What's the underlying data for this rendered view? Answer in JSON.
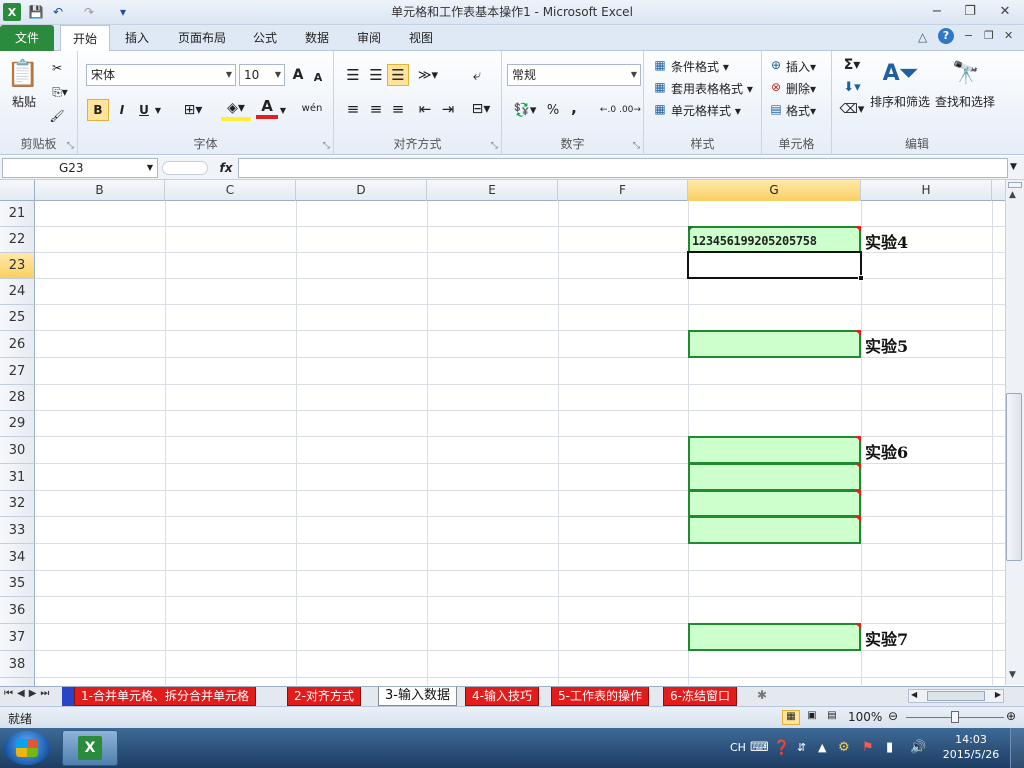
{
  "window": {
    "title": "单元格和工作表基本操作1 - Microsoft Excel",
    "app_icon": "excel-icon",
    "controls": {
      "minimize": "−",
      "maximize": "❐",
      "close": "✕"
    }
  },
  "quick_access": {
    "save": "save-icon",
    "undo": "undo-icon",
    "redo": "redo-icon",
    "customize": "▾"
  },
  "ribbon_tabs": [
    "文件",
    "开始",
    "插入",
    "页面布局",
    "公式",
    "数据",
    "审阅",
    "视图"
  ],
  "active_tab": "开始",
  "ribbon": {
    "clipboard": {
      "label": "剪贴板",
      "paste": "粘贴"
    },
    "font": {
      "label": "字体",
      "name": "宋体",
      "size": "10",
      "bold": "B",
      "italic": "I",
      "underline": "U",
      "grow": "A",
      "shrink": "A",
      "wen": "wén",
      "fontcolor": "A"
    },
    "alignment": {
      "label": "对齐方式"
    },
    "number": {
      "label": "数字",
      "format": "常规",
      "percent": "%",
      "comma": ","
    },
    "styles": {
      "label": "样式",
      "conditional": "条件格式",
      "table": "套用表格格式",
      "cell_styles": "单元格样式"
    },
    "cells": {
      "label": "单元格",
      "insert": "插入",
      "delete": "删除",
      "format": "格式"
    },
    "editing": {
      "label": "编辑",
      "sum": "Σ",
      "sort_filter": "排序和筛选",
      "find_select": "查找和选择"
    }
  },
  "formula_bar": {
    "name_box": "G23",
    "fx": "fx",
    "content": ""
  },
  "columns": [
    "B",
    "C",
    "D",
    "E",
    "F",
    "G",
    "H"
  ],
  "selected_column": "G",
  "rows": [
    "21",
    "22",
    "23",
    "24",
    "25",
    "26",
    "27",
    "28",
    "29",
    "30",
    "31",
    "32",
    "33",
    "34",
    "35",
    "36",
    "37",
    "38"
  ],
  "selected_row": "23",
  "cells": {
    "g22": "123456199205205758",
    "exp4": "实验4",
    "exp5": "实验5",
    "exp6": "实验6",
    "exp7": "实验7"
  },
  "sheet_tabs": [
    "1-合并单元格、拆分合并单元格",
    "2-对齐方式",
    "3-输入数据",
    "4-输入技巧",
    "5-工作表的操作",
    "6-冻结窗口"
  ],
  "active_sheet": "3-输入数据",
  "status": {
    "mode": "就绪",
    "zoom": "100%"
  },
  "taskbar": {
    "lang": "CH",
    "time": "14:03",
    "date": "2015/5/26"
  }
}
